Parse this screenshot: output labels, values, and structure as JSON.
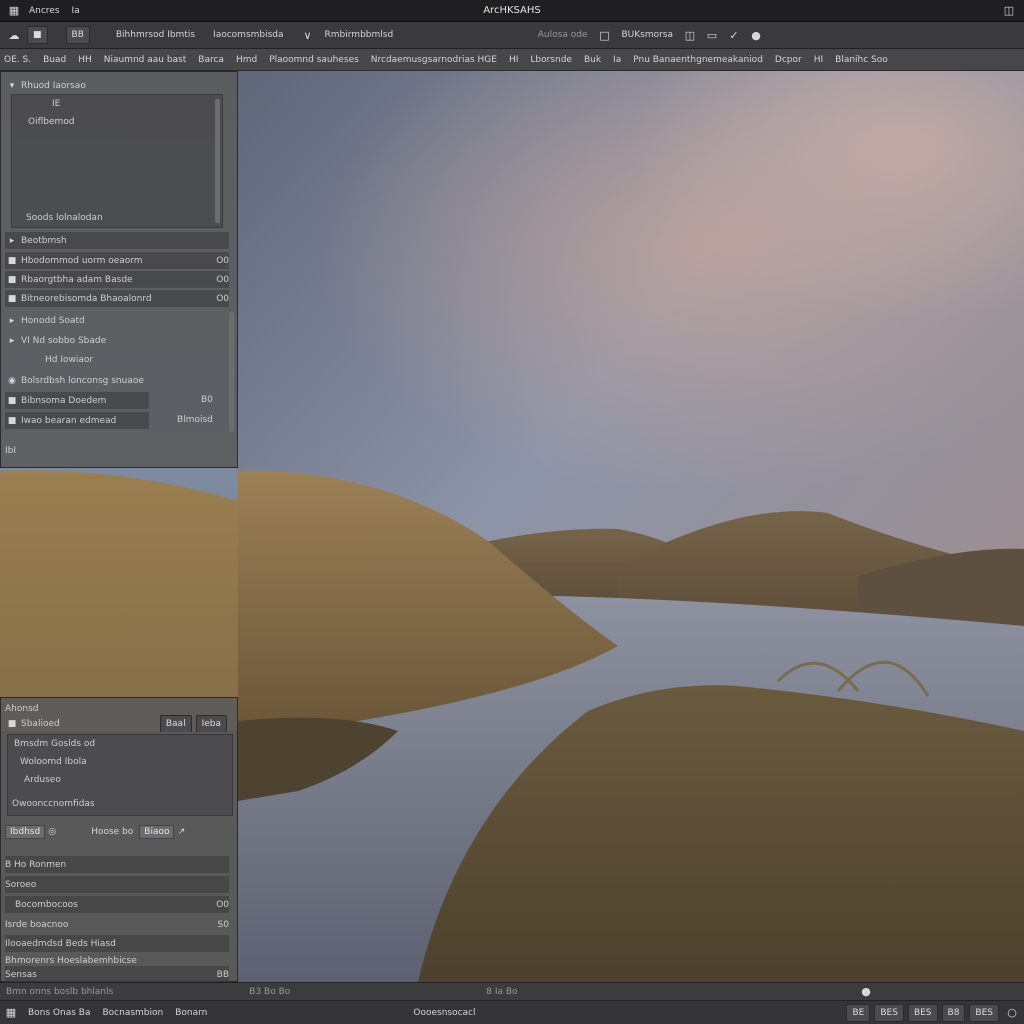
{
  "titlebar": {
    "app_icon": "grid-icon",
    "menus": [
      "Ancres",
      "Ia"
    ],
    "title": "ArcHKSAHS",
    "right_icon": "window-icon"
  },
  "toolbar": {
    "items": [
      "BB",
      "Bihhmrsod Ibmtis",
      "Iaocomsmbisda",
      "Rmbirmbbmlsd"
    ],
    "right_text": "Aulosa ode",
    "zoom_label": "BUKsmorsa"
  },
  "optionsbar": {
    "items": [
      "OE. S.",
      "Buad",
      "HH",
      "Niaumnd aau bast",
      "Barca",
      "Hmd",
      "Plaoomnd sauheses",
      "Nrcdaemusgsarnodrias HGE",
      "HI",
      "Lborsnde",
      "Buk",
      "Ia",
      "Pnu Banaenthgnemeakaniod",
      "Dcpor",
      "HI",
      "Blanihc Soo"
    ]
  },
  "panel_top": {
    "header": "Rhuod Iaorsao",
    "inner_rows": [
      "IE",
      "Oiflbemod"
    ],
    "inner_footer": "Soods lolnalodan",
    "rows": [
      {
        "label": "Beotbmsh",
        "value": ""
      },
      {
        "label": "Hbodommod uorm oeaorm",
        "value": "O0"
      },
      {
        "label": "Rbaorgtbha adam Basde",
        "value": "O0"
      },
      {
        "label": "Bitneorebisomda Bhaoalonrd",
        "value": "O0"
      },
      {
        "label": "Honodd Soatd",
        "value": ""
      },
      {
        "label": "VI Nd sobbo Sbade",
        "value": ""
      },
      {
        "label": "Hd Iowiaor",
        "value": ""
      },
      {
        "label": "Bolsrdbsh lonconsg snuaoe",
        "value": ""
      },
      {
        "label": "Bibnsoma Doedem",
        "value": "B0"
      },
      {
        "label": "Iwao bearan edmead",
        "value": "Blmoisd"
      }
    ],
    "footer": "IbI"
  },
  "panel_bottom": {
    "header": "Ahonsd",
    "row1_label": "Sbalioed",
    "row1_buttons": [
      "Baal",
      "Ieba"
    ],
    "inner_rows": [
      "Bmsdm Goslds od",
      "Woloomd Ibola",
      "Arduseo"
    ],
    "inner_footer": "Owoonccnomfidas",
    "tool_row": [
      "Ibdhsd",
      "Hoose bo",
      "Biaoo"
    ],
    "rows": [
      {
        "label": "B Ho Ronmen",
        "value": ""
      },
      {
        "label": "Soroeo",
        "value": ""
      },
      {
        "label": "Bocombocoos",
        "value": "O0"
      },
      {
        "label": "Isrde boacnoo",
        "value": "S0"
      },
      {
        "label": "Ilooaedmdsd Beds Hiasd",
        "value": ""
      },
      {
        "label": "Bhmorenrs Hoeslabemhbicse",
        "value": ""
      },
      {
        "label": "Sensas",
        "value": "BB"
      }
    ]
  },
  "statusbar1": {
    "left": "Bmn onns boslb bhlanls",
    "center": "B3 Bo Bo",
    "right": "8 Ia Bo"
  },
  "statusbar2": {
    "left_items": [
      "Bons Onas Ba",
      "Bocnasmbion",
      "Bonarn"
    ],
    "center": "Oooesnsocacl",
    "right_items": [
      "BE",
      "BES",
      "BES",
      "B8",
      "BES"
    ]
  }
}
